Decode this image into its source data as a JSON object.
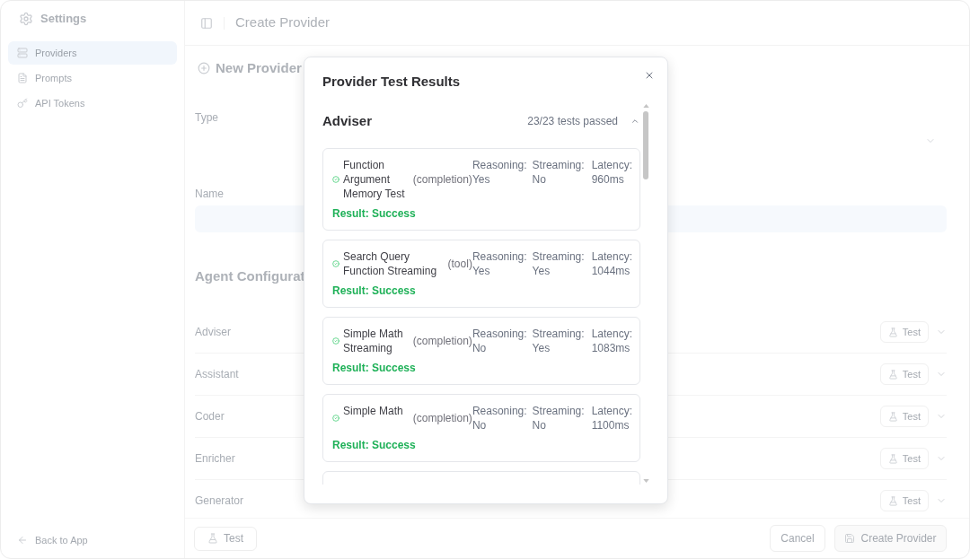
{
  "sidebar": {
    "title": "Settings",
    "items": [
      {
        "label": "Providers",
        "selected": true
      },
      {
        "label": "Prompts",
        "selected": false
      },
      {
        "label": "API Tokens",
        "selected": false
      }
    ],
    "back_link": "Back to App"
  },
  "header": {
    "title": "Create Provider"
  },
  "form": {
    "title": "New Provider",
    "fields": [
      {
        "label": "Type",
        "kind": "select"
      },
      {
        "label": "Name",
        "kind": "input"
      }
    ],
    "agents_title": "Agent Configurat",
    "agents": [
      {
        "name": "Adviser",
        "button": "Test",
        "expanded": false
      },
      {
        "name": "Assistant",
        "button": "Test",
        "expanded": false
      },
      {
        "name": "Coder",
        "button": "Test",
        "expanded": false
      },
      {
        "name": "Enricher",
        "button": "Test",
        "expanded": false
      },
      {
        "name": "Generator",
        "button": "Test",
        "expanded": false
      }
    ]
  },
  "footer": {
    "test_button": "Test",
    "cancel_button": "Cancel",
    "submit_button": "Create Provider"
  },
  "dialog": {
    "title": "Provider Test Results",
    "group": {
      "name": "Adviser",
      "summary": "23/23 tests passed",
      "expanded": true,
      "tests": [
        {
          "name": "Function Argument Memory Test",
          "type": "(completion)",
          "reasoning_label": "Reasoning:",
          "reasoning": "Yes",
          "streaming_label": "Streaming:",
          "streaming": "No",
          "latency_label": "Latency:",
          "latency": "960ms",
          "result": "Result: Success",
          "passed": true
        },
        {
          "name": "Search Query Function Streaming",
          "type": "(tool)",
          "reasoning_label": "Reasoning:",
          "reasoning": "Yes",
          "streaming_label": "Streaming:",
          "streaming": "Yes",
          "latency_label": "Latency:",
          "latency": "1044ms",
          "result": "Result: Success",
          "passed": true
        },
        {
          "name": "Simple Math Streaming",
          "type": "(completion)",
          "reasoning_label": "Reasoning:",
          "reasoning": "No",
          "streaming_label": "Streaming:",
          "streaming": "Yes",
          "latency_label": "Latency:",
          "latency": "1083ms",
          "result": "Result: Success",
          "passed": true
        },
        {
          "name": "Simple Math",
          "type": "(completion)",
          "reasoning_label": "Reasoning:",
          "reasoning": "No",
          "streaming_label": "Streaming:",
          "streaming": "No",
          "latency_label": "Latency:",
          "latency": "1100ms",
          "result": "Result: Success",
          "passed": true
        }
      ]
    }
  }
}
